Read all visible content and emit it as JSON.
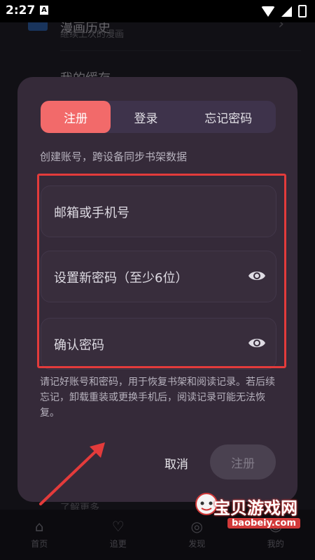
{
  "status_bar": {
    "time": "2:27",
    "notification_letter": "A"
  },
  "background": {
    "history_title": "漫画历史",
    "history_subtitle": "继续上次的漫画",
    "cache_title": "我的缓存",
    "more_text": "了解更多"
  },
  "bottom_nav": {
    "items": [
      {
        "label": "首页",
        "icon": "home-icon"
      },
      {
        "label": "追更",
        "icon": "heart-icon"
      },
      {
        "label": "发现",
        "icon": "discover-icon"
      },
      {
        "label": "我的",
        "icon": "profile-icon"
      }
    ]
  },
  "dialog": {
    "tabs": [
      "注册",
      "登录",
      "忘记密码"
    ],
    "active_tab": "注册",
    "subtitle": "创建账号，跨设备同步书架数据",
    "fields": {
      "email_placeholder": "邮箱或手机号",
      "password_placeholder": "设置新密码（至少6位）",
      "confirm_placeholder": "确认密码"
    },
    "note": "请记好账号和密码，用于恢复书架和阅读记录。若后续忘记，卸载重装或更换手机后，阅读记录可能无法恢复。",
    "cancel_label": "取消",
    "register_label": "注册"
  },
  "watermark": {
    "title": "宝贝游戏网",
    "url": "baobeiy.com"
  },
  "colors": {
    "accent": "#f26a6a",
    "dialog_bg": "#352a39",
    "highlight": "#e33b3b"
  }
}
